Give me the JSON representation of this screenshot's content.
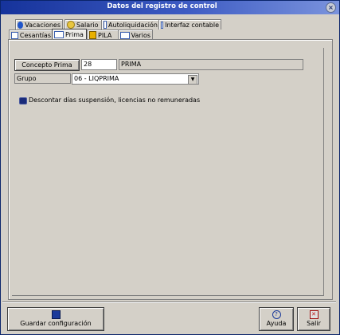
{
  "window": {
    "title": "Datos del registro de control",
    "close_symbol": "×"
  },
  "tabs_row1": [
    {
      "label": "Vacaciones",
      "icon": "vacation-icon"
    },
    {
      "label": "Salario",
      "icon": "salary-icon"
    },
    {
      "label": "Autoliquidación",
      "icon": "document-icon"
    },
    {
      "label": "Interfaz contable",
      "icon": "table-icon"
    }
  ],
  "tabs_row2": [
    {
      "label": "Cesantías",
      "icon": "table-icon"
    },
    {
      "label": "Prima",
      "icon": "table-icon",
      "active": true
    },
    {
      "label": "PILA",
      "icon": "pila-icon"
    },
    {
      "label": "Varios",
      "icon": "table-icon"
    }
  ],
  "form": {
    "concepto_button": "Concepto Prima",
    "concepto_code": "28",
    "concepto_name": "PRIMA",
    "grupo_label": "Grupo",
    "grupo_value": "06 - LIQPRIMA",
    "dropdown_arrow": "▼",
    "descontar_label": "Descontar días suspensión, licencias no remuneradas",
    "descontar_checked": true
  },
  "footer": {
    "save_label": "Guardar configuración",
    "help_label": "Ayuda",
    "help_symbol": "?",
    "exit_label": "Salir",
    "exit_symbol": "✕"
  },
  "colors": {
    "titlebar": "#16339b",
    "background": "#d4d0c8"
  }
}
